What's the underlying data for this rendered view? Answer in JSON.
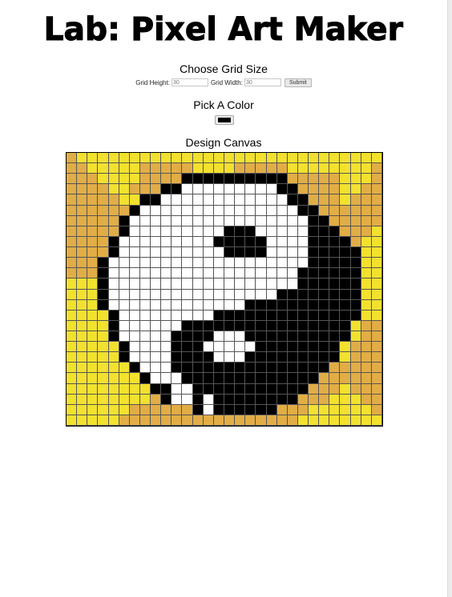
{
  "title": "Lab: Pixel Art Maker",
  "grid_size": {
    "heading": "Choose Grid Size",
    "height_label": "Grid Height:",
    "height_value": "30",
    "width_label": "Grid Width:",
    "width_value": "30",
    "submit_label": "Submit"
  },
  "color": {
    "heading": "Pick A Color",
    "value": "#000000"
  },
  "canvas": {
    "heading": "Design Canvas",
    "palette": {
      "Y": "#f2e12f",
      "O": "#e1ad46",
      "K": "#000000",
      "W": "#ffffff"
    },
    "rows": [
      "OYYYYYYYYYYYYYYYYYYYYYYYYYYYYY",
      "OOYYYYYOOOOOYYYYOOOOOYYYYYYYYO",
      "OOOYYYYOOOOKKKKKKKKKKOOOOOYYYO",
      "OOOOYYOOOKKWWWWWWWWWKKOOOOYYOO",
      "OOOOOYYKKWWWWWWWWWWWWKKOOOYOOO",
      "OOOOOOKWWWWWWWWWWWWWWWKKOOOOOO",
      "OOOOOKWWWWWWWWWWWWWWWWWKKOOOOO",
      "OOOOOKWWWWWWWWWKKKWWWWWKKKOOOY",
      "OOOOKWWWWWWWWWKKKKKWWWWKKKKOYY",
      "OOOOKWWWWWWWWWWKKKKWWWWKKKKKYY",
      "OOOKWWWWWWWWWWWWWWWWWWWKKKKKYY",
      "OOOKWWWWWWWWWWWWWWWWWWKKKKKKYY",
      "YYYKWWWWWWWWWWWWWWWWWWKKKKKKYY",
      "YYYKWWWWWWWWWWWWWWWWKKKKKKKKYY",
      "YYYKWWWWWWWWWWWWWKKKKKKKKKKKYY",
      "YYYYKWWWWWWWWWKKKKKKKKKKKKKKYY",
      "YYYYKWWWWWWKKKKKKKKKKKKKKKKYOO",
      "YYYYKWWWWWKKKKWWWKKKKKKKKKKYOO",
      "YYYYYKWWWWKKKWWWWWKKKKKKKKYOOO",
      "YYYYYKWWWWKKKKWWWKKKKKKKKKYOOO",
      "YYYYYYKWWWKKKKKKKKKKKKKKKOOOOO",
      "YYYYYYYKWWWKKKKKKKKKKKKKOOOOOO",
      "YYYYYYYYKKWWKKKKKKKKKKKOOOYOOO",
      "YYYYYYYYOKWWKWKKKKKKKKOOOYYYOO",
      "YYYYYYOOOOOOKWKKKKKKOOOYYYYYYO",
      "YYYYYOOOOOOOOOOOOOOOOOYYYYYYYY"
    ]
  }
}
